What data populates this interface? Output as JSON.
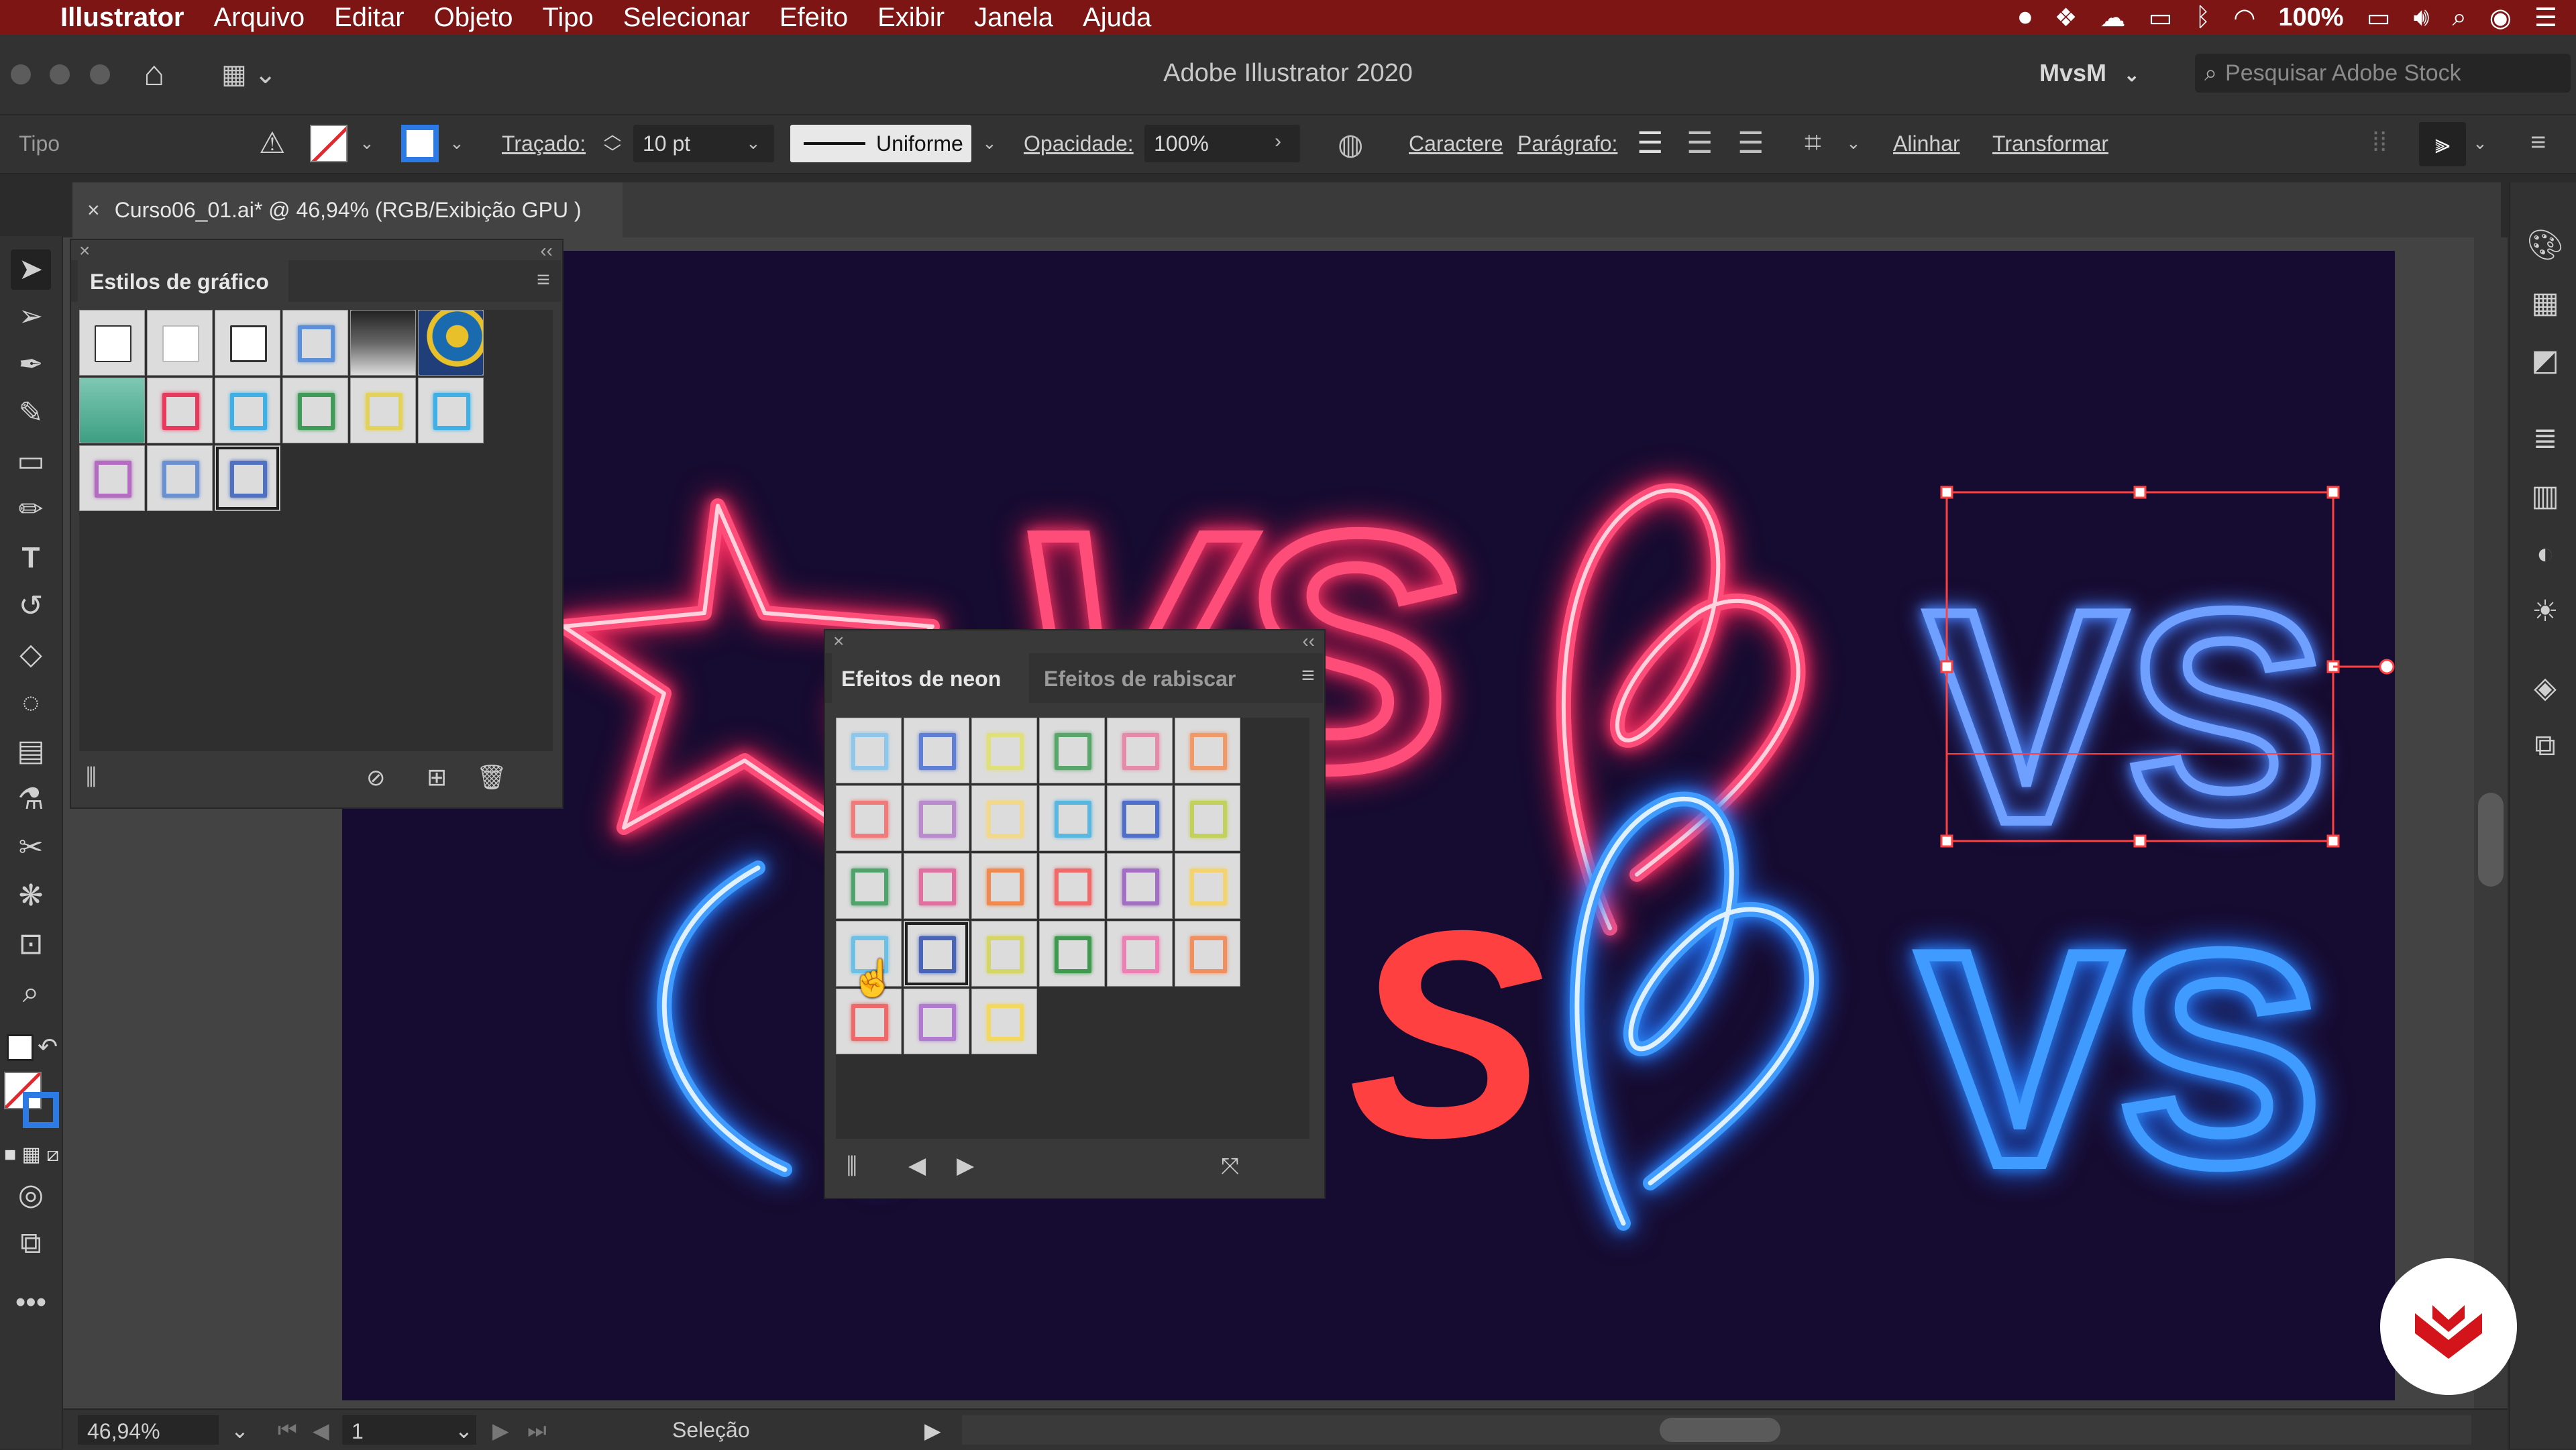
{
  "menubar": {
    "app": "Illustrator",
    "items": [
      "Arquivo",
      "Editar",
      "Objeto",
      "Tipo",
      "Selecionar",
      "Efeito",
      "Exibir",
      "Janela",
      "Ajuda"
    ],
    "battery": "100%"
  },
  "titlebar": {
    "title": "Adobe Illustrator 2020",
    "workspace": "MvsM",
    "stock_placeholder": "Pesquisar Adobe Stock"
  },
  "control": {
    "mode": "Tipo",
    "stroke_label": "Traçado:",
    "stroke_value": "10 pt",
    "profile": "Uniforme",
    "opacity_label": "Opacidade:",
    "opacity_value": "100%",
    "character": "Caractere",
    "paragraph": "Parágrafo:",
    "align": "Alinhar",
    "transform": "Transformar"
  },
  "document": {
    "tab_close": "×",
    "tab_name": "Curso06_01.ai* @ 46,94% (RGB/Exibição GPU )"
  },
  "graphic_styles": {
    "title": "Estilos de gráfico",
    "swatch_colors": [
      "#ffffff",
      "#ffffff",
      "#ffffff",
      "#5b8fd9",
      "#444444",
      "#1f3e7a",
      "#58b49a",
      "#e83a5c",
      "#3fb0e6",
      "#3f9b57",
      "#e2d25a",
      "#3fb0e6",
      "#b36cc2",
      "#6a90cf",
      "#5070c0"
    ]
  },
  "neon_panel": {
    "tab_active": "Efeitos de neon",
    "tab_inactive": "Efeitos de rabiscar",
    "swatch_colors": [
      "#8ec7ea",
      "#5f7fd6",
      "#dfe07a",
      "#58a66a",
      "#e58aa8",
      "#f09a6a",
      "#ef7b7b",
      "#b98bcc",
      "#f1d88a",
      "#5ab8e0",
      "#4f6fc9",
      "#c2d15b",
      "#4fa36b",
      "#e070a0",
      "#f08a50",
      "#ef6b6b",
      "#a36fc3",
      "#f3d36f",
      "#6cc0e6",
      "#4a64b8",
      "#d6d666",
      "#3f9a50",
      "#ec7fb3",
      "#f09060",
      "#ee6a6a",
      "#b07ad0",
      "#f3d860"
    ]
  },
  "status": {
    "zoom": "46,94%",
    "artboard": "1",
    "mode": "Seleção"
  },
  "artwork": {
    "top_text": "VS",
    "bottom_text": "VS",
    "partial_s": "S"
  }
}
